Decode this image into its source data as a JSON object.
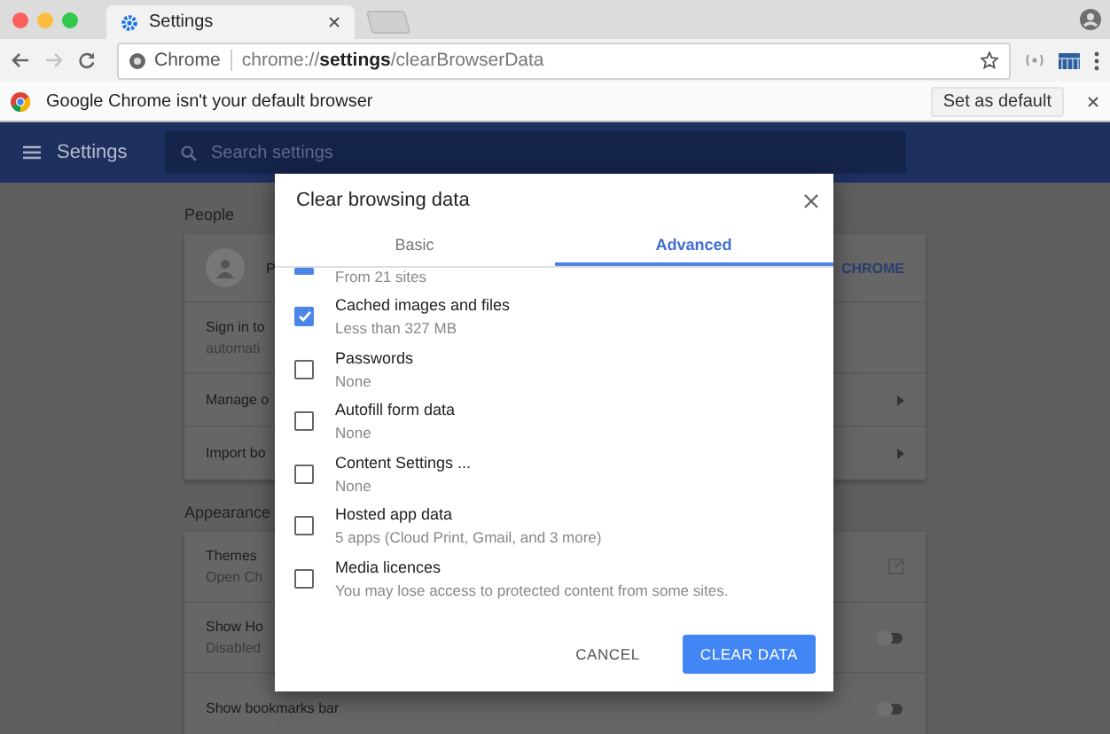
{
  "window": {
    "tab_title": "Settings"
  },
  "address_bar": {
    "site_label": "Chrome",
    "url": "chrome://**settings**/clearBrowserData"
  },
  "infobar": {
    "message": "Google Chrome isn't your default browser",
    "button": "Set as default"
  },
  "settings_header": {
    "title": "Settings",
    "search": {
      "placeholder": "Search settings"
    }
  },
  "sections": [
    {
      "heading": "People",
      "rows": [
        {
          "kind": "profile",
          "label": "P",
          "action": "CHROME"
        },
        {
          "kind": "text",
          "label": "Sign in to",
          "sublabel": "automati"
        },
        {
          "kind": "link",
          "label": "Manage o"
        },
        {
          "kind": "link",
          "label": "Import bo"
        }
      ]
    },
    {
      "heading": "Appearance",
      "rows": [
        {
          "kind": "external",
          "label": "Themes",
          "sublabel": "Open Ch"
        },
        {
          "kind": "toggle",
          "label": "Show Ho",
          "sublabel": "Disabled",
          "on": false
        },
        {
          "kind": "toggle",
          "label": "Show bookmarks bar",
          "on": false
        }
      ]
    }
  ],
  "dialog": {
    "title": "Clear browsing data",
    "tabs": [
      {
        "label": "Basic",
        "selected": false
      },
      {
        "label": "Advanced",
        "selected": true
      }
    ],
    "items": [
      {
        "kind": "partial",
        "sublabel": "From 21 sites",
        "checked": true
      },
      {
        "kind": "full",
        "label": "Cached images and files",
        "sublabel": "Less than 327 MB",
        "checked": true
      },
      {
        "kind": "full",
        "label": "Passwords",
        "sublabel": "None",
        "checked": false
      },
      {
        "kind": "full",
        "label": "Autofill form data",
        "sublabel": "None",
        "checked": false
      },
      {
        "kind": "full",
        "label": "Content Settings ...",
        "sublabel": "None",
        "checked": false
      },
      {
        "kind": "full",
        "label": "Hosted app data",
        "sublabel": "5 apps (Cloud Print, Gmail, and 3 more)",
        "checked": false
      },
      {
        "kind": "full",
        "label": "Media licences",
        "sublabel": "You may lose access to protected content from some sites.",
        "checked": false
      }
    ],
    "buttons": [
      {
        "kind": "text",
        "label": "CANCEL"
      },
      {
        "kind": "primary",
        "label": "CLEAR DATA"
      }
    ]
  }
}
